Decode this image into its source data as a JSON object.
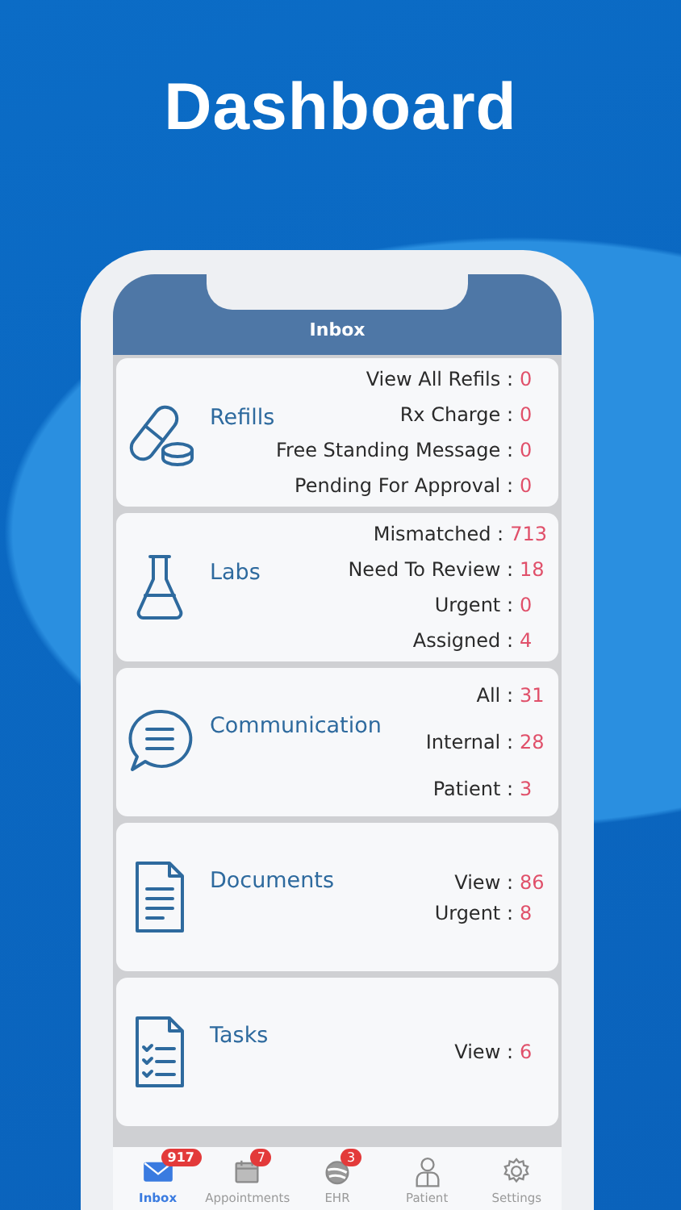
{
  "headline": "Dashboard",
  "screen": {
    "title": "Inbox",
    "cards": [
      {
        "kind": "refills",
        "title": "Refills",
        "stats": [
          {
            "label": "View All Refils :",
            "value": "0"
          },
          {
            "label": "Rx Charge :",
            "value": "0"
          },
          {
            "label": "Free Standing Message :",
            "value": "0"
          },
          {
            "label": "Pending For Approval :",
            "value": "0"
          }
        ]
      },
      {
        "kind": "labs",
        "title": "Labs",
        "stats": [
          {
            "label": "Mismatched :",
            "value": "713"
          },
          {
            "label": "Need To Review :",
            "value": "18"
          },
          {
            "label": "Urgent :",
            "value": "0"
          },
          {
            "label": "Assigned :",
            "value": "4"
          }
        ]
      },
      {
        "kind": "communication",
        "title": "Communication",
        "stats": [
          {
            "label": "All :",
            "value": "31"
          },
          {
            "label": "Internal :",
            "value": "28"
          },
          {
            "label": "Patient :",
            "value": "3"
          }
        ]
      },
      {
        "kind": "documents",
        "title": "Documents",
        "stats": [
          {
            "label": "View :",
            "value": "86"
          },
          {
            "label": "Urgent :",
            "value": "8"
          }
        ]
      },
      {
        "kind": "tasks",
        "title": "Tasks",
        "stats": [
          {
            "label": "View :",
            "value": "6"
          }
        ]
      }
    ],
    "tabs": [
      {
        "kind": "inbox",
        "label": "Inbox",
        "badge": "917",
        "selected": true
      },
      {
        "kind": "appointments",
        "label": "Appointments",
        "badge": "7",
        "selected": false
      },
      {
        "kind": "ehr",
        "label": "EHR",
        "badge": "3",
        "selected": false
      },
      {
        "kind": "patient",
        "label": "Patient",
        "selected": false
      },
      {
        "kind": "settings",
        "label": "Settings",
        "selected": false
      }
    ]
  }
}
